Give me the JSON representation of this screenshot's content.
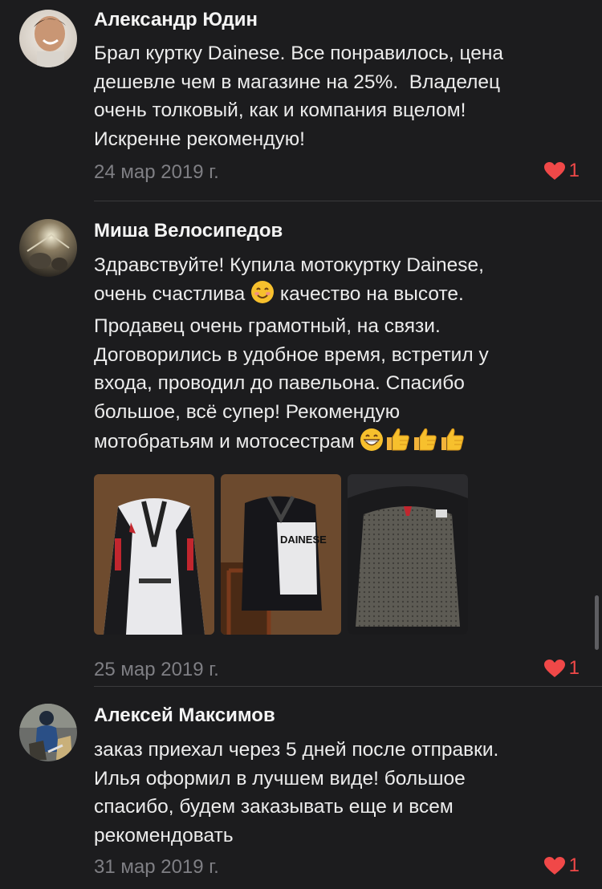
{
  "reviews": [
    {
      "author": "Александр Юдин",
      "lines": [
        "Брал куртку Dainese. Все понравилось, цена",
        "дешевле чем в магазине на 25%.  Владелец",
        "очень толковый, как и компания вцелом!",
        "Искренне рекомендую!"
      ],
      "date": "24 мар 2019 г.",
      "likes": "1"
    },
    {
      "author": "Миша Велосипедов",
      "lines": [
        "Здравствуйте! Купила мотокуртку Dainese,",
        "очень счастлива",
        "качество на высоте.",
        "Продавец очень грамотный, на связи.",
        "Договорились в удобное время, встретил у",
        "входа, проводил до павельона. Спасибо",
        "большое, всё супер! Рекомендую",
        "мотобратьям и мотосестрам"
      ],
      "date": "25 мар 2019 г.",
      "likes": "1",
      "photos": [
        "jacket-front-white",
        "jacket-side-dainese",
        "jacket-inside-lining"
      ]
    },
    {
      "author": "Алексей Максимов",
      "lines": [
        "заказ приехал через 5 дней после отправки.",
        "Илья оформил в лучшем виде! большое",
        "спасибо, будем заказывать еще и всем",
        "рекомендовать"
      ],
      "date": "31 мар 2019 г.",
      "likes": "1"
    }
  ],
  "icons": {
    "like": "heart-icon",
    "smile": "smiling-face-emoji",
    "grin": "grinning-face-emoji",
    "thumbs": "thumbs-up-emoji"
  },
  "colors": {
    "background": "#1c1c1e",
    "text": "#ececec",
    "date": "#7f7f84",
    "like": "#f04848",
    "separator": "#3a3a3c"
  }
}
